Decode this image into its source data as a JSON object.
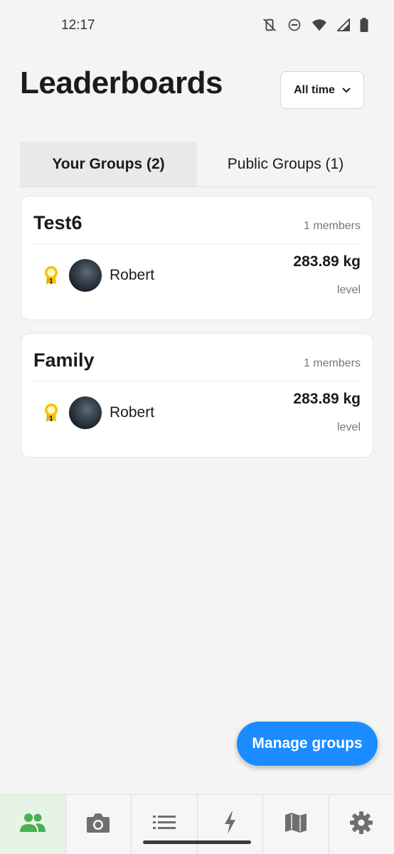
{
  "status_bar": {
    "time": "12:17",
    "icons": [
      "vibrate-off-icon",
      "do-not-disturb-icon",
      "wifi-icon",
      "cellular-signal-icon",
      "battery-icon"
    ]
  },
  "header": {
    "title": "Leaderboards",
    "time_filter": {
      "selected": "All time",
      "icon": "chevron-down-icon"
    }
  },
  "tabs": [
    {
      "label": "Your Groups (2)",
      "active": true
    },
    {
      "label": "Public Groups (1)",
      "active": false
    }
  ],
  "groups": [
    {
      "name": "Test6",
      "members_label": "1 members",
      "entries": [
        {
          "rank": "1",
          "name": "Robert",
          "score": "283.89 kg",
          "unit_label": "level"
        }
      ]
    },
    {
      "name": "Family",
      "members_label": "1 members",
      "entries": [
        {
          "rank": "1",
          "name": "Robert",
          "score": "283.89 kg",
          "unit_label": "level"
        }
      ]
    }
  ],
  "fab": {
    "label": "Manage groups"
  },
  "bottom_nav": [
    {
      "icon": "groups-icon",
      "active": true
    },
    {
      "icon": "camera-icon",
      "active": false
    },
    {
      "icon": "list-icon",
      "active": false
    },
    {
      "icon": "lightning-icon",
      "active": false
    },
    {
      "icon": "map-icon",
      "active": false
    },
    {
      "icon": "gear-icon",
      "active": false
    }
  ],
  "colors": {
    "accent": "#1a8cff",
    "nav_active": "#4caf50",
    "medal": "#f2c400"
  }
}
